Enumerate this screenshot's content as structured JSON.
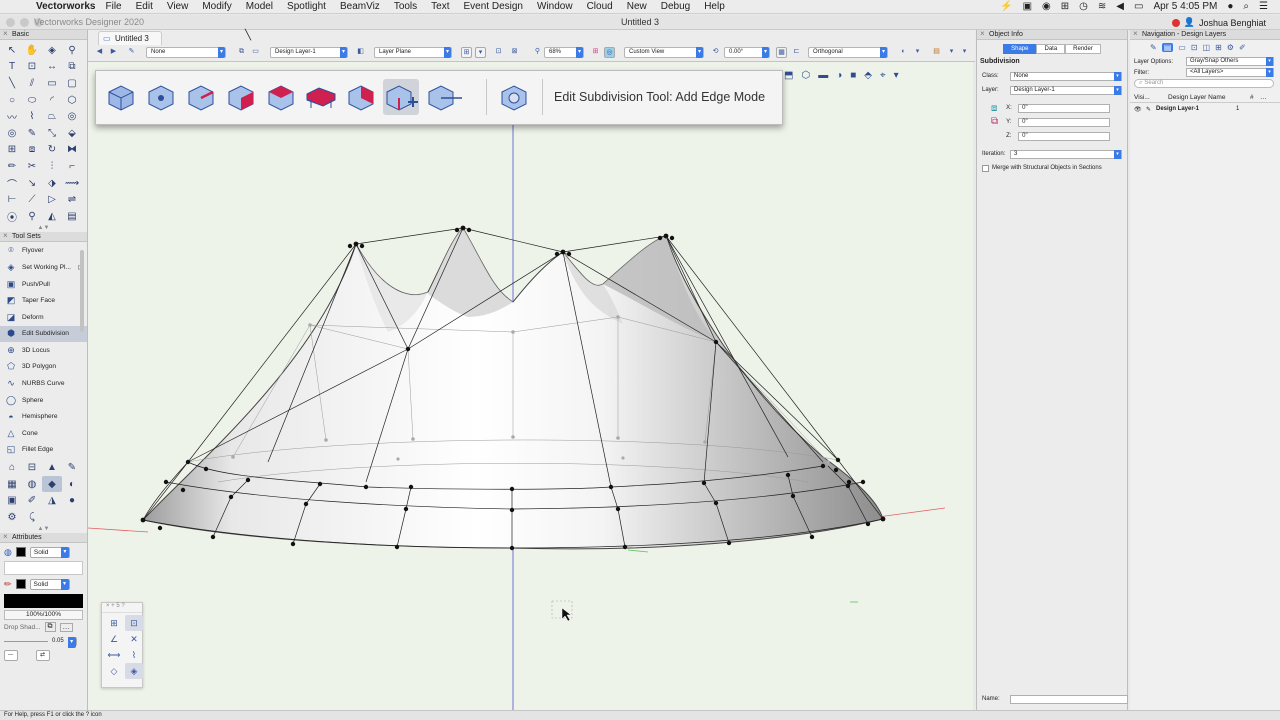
{
  "menubar": {
    "app_name": "Vectorworks",
    "items": [
      "File",
      "Edit",
      "View",
      "Modify",
      "Model",
      "Spotlight",
      "BeamViz",
      "Tools",
      "Text",
      "Event Design",
      "Window",
      "Cloud",
      "New",
      "Debug",
      "Help"
    ],
    "clock": "Apr 5  4:05 PM"
  },
  "window": {
    "app_title": "Vectorworks Designer 2020",
    "doc_title": "Untitled 3",
    "user": "Joshua Benghiat"
  },
  "tabs": [
    {
      "label": "Untitled 3"
    }
  ],
  "viewbar": {
    "class": "None",
    "layer": "Design Layer-1",
    "plane": "Layer Plane",
    "zoom": "68%",
    "view": "Custom View",
    "rotation": "0.00°",
    "projection": "Orthogonal"
  },
  "palettes": {
    "basic_title": "Basic",
    "toolsets_title": "Tool Sets",
    "attributes_title": "Attributes"
  },
  "toolsets": [
    {
      "label": "Flyover",
      "icon": "flyover-icon"
    },
    {
      "label": "Set Working Pl...",
      "icon": "working-plane-icon"
    },
    {
      "label": "Push/Pull",
      "icon": "push-pull-icon"
    },
    {
      "label": "Taper Face",
      "icon": "taper-face-icon"
    },
    {
      "label": "Deform",
      "icon": "deform-icon"
    },
    {
      "label": "Edit Subdivision",
      "icon": "edit-subdivision-icon",
      "selected": true
    },
    {
      "label": "3D Locus",
      "icon": "locus-icon"
    },
    {
      "label": "3D Polygon",
      "icon": "polygon-3d-icon"
    },
    {
      "label": "NURBS Curve",
      "icon": "nurbs-curve-icon"
    },
    {
      "label": "Sphere",
      "icon": "sphere-icon"
    },
    {
      "label": "Hemisphere",
      "icon": "hemisphere-icon"
    },
    {
      "label": "Cone",
      "icon": "cone-icon"
    },
    {
      "label": "Fillet Edge",
      "icon": "fillet-edge-icon"
    }
  ],
  "attributes": {
    "fill_style": "Solid",
    "pen_style": "Solid",
    "opacity": "100%/100%",
    "drop_shadow": "Drop Shad...",
    "line_weight": "0.05"
  },
  "modebar": {
    "label": "Edit Subdivision Tool: Add Edge Mode"
  },
  "object_info": {
    "title": "Object Info",
    "tabs": [
      "Shape",
      "Data",
      "Render"
    ],
    "object_type": "Subdivision",
    "class_label": "Class:",
    "class_value": "None",
    "layer_label": "Layer:",
    "layer_value": "Design Layer-1",
    "x_label": "X:",
    "x_value": "0\"",
    "y_label": "Y:",
    "y_value": "0\"",
    "z_label": "Z:",
    "z_value": "0\"",
    "iteration_label": "Iteration:",
    "iteration_value": "3",
    "merge_label": "Merge with Structural Objects in Sections",
    "name_label": "Name:"
  },
  "navigation": {
    "title": "Navigation - Design Layers",
    "layer_options_label": "Layer Options:",
    "layer_options_value": "Gray/Snap Others",
    "filter_label": "Filter:",
    "filter_value": "<All Layers>",
    "search_placeholder": "Search",
    "col_visibility": "Visi...",
    "col_name": "Design Layer Name",
    "col_number": "#",
    "rows": [
      {
        "name": "Design Layer-1",
        "number": "1"
      }
    ]
  },
  "statusbar": {
    "text": "For Help, press F1 or click the ? icon"
  }
}
